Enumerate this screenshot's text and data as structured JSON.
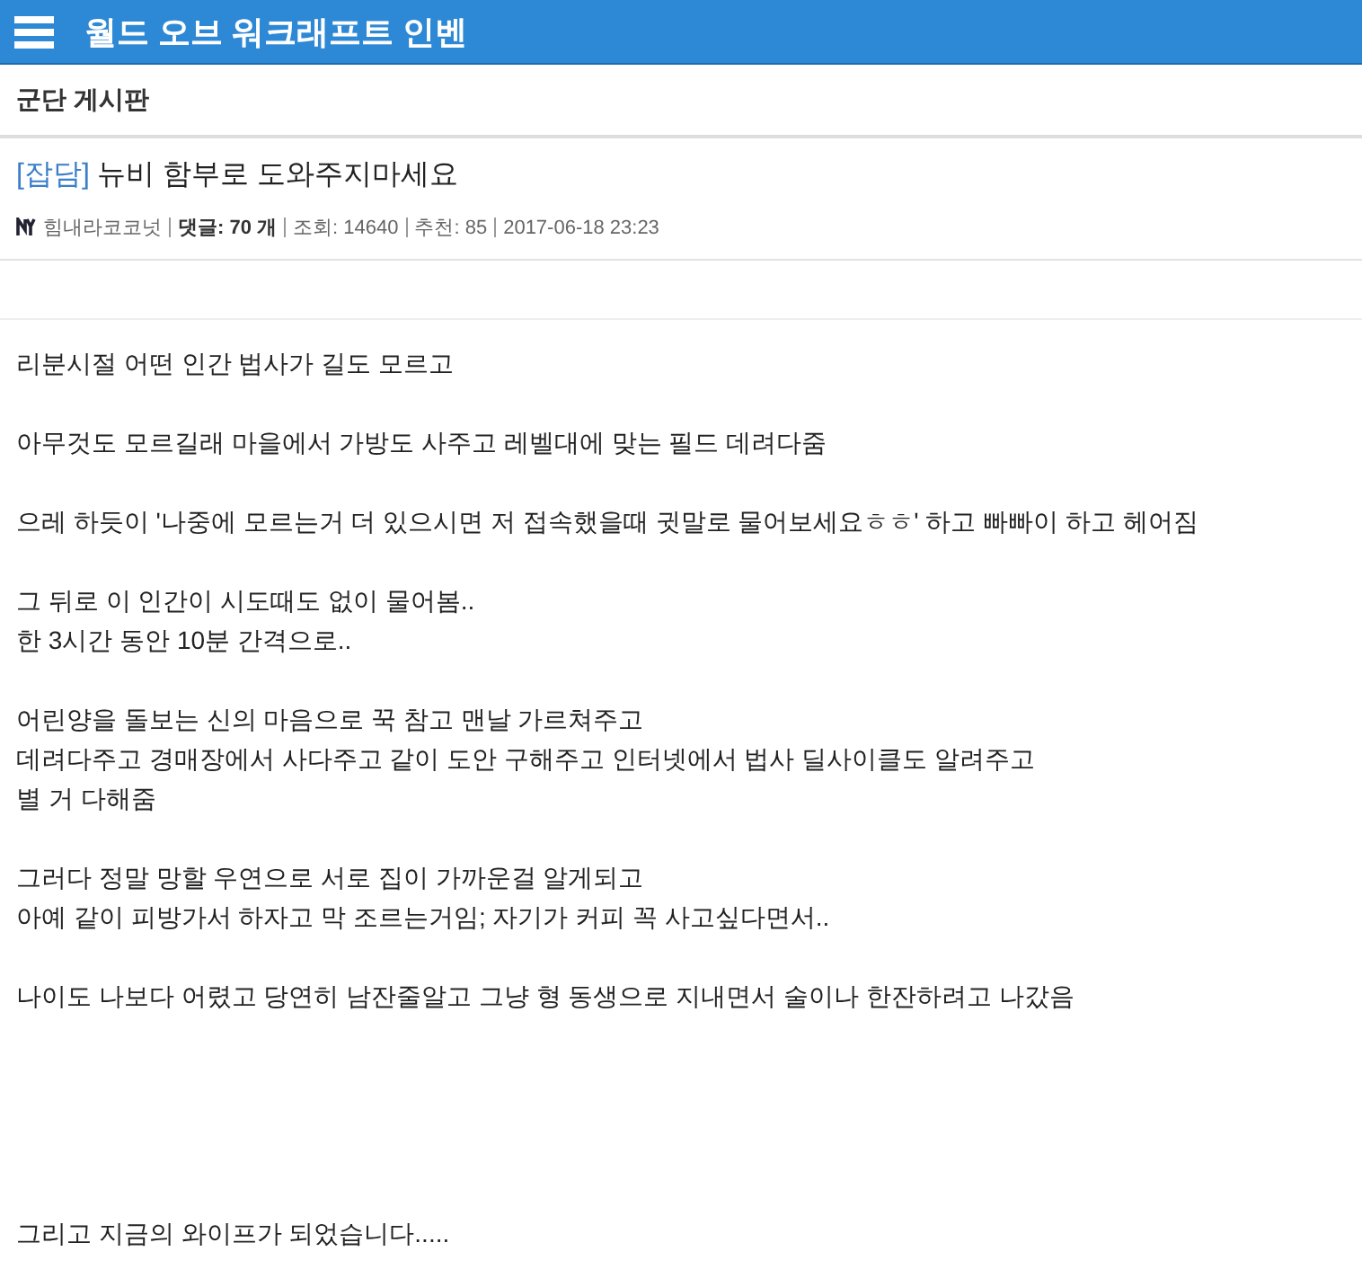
{
  "header": {
    "title": "월드 오브 워크래프트 인벤"
  },
  "board": {
    "title": "군단 게시판"
  },
  "post": {
    "category": "[잡담]",
    "title": "뉴비 함부로 도와주지마세요",
    "meta": {
      "author": "힘내라코코넛",
      "comments": "**댓글: 70 개**",
      "views": "조회: 14640",
      "recommends": "추천: 85",
      "date": "2017-06-18 23:23"
    },
    "paragraphs": [
      {
        "lines": [
          "리분시절 어떤 인간 법사가 길도 모르고"
        ]
      },
      {
        "lines": [
          "아무것도 모르길래 마을에서 가방도 사주고 레벨대에 맞는 필드 데려다줌"
        ]
      },
      {
        "lines": [
          "으레 하듯이 '나중에 모르는거 더 있으시면 저 접속했을때 귓말로 물어보세요ㅎㅎ' 하고 빠빠이 하고 헤어짐"
        ]
      },
      {
        "lines": [
          "그 뒤로 이 인간이 시도때도 없이 물어봄..",
          "한 3시간 동안 10분 간격으로.."
        ]
      },
      {
        "lines": [
          "어린양을 돌보는 신의 마음으로 꾹 참고 맨날 가르쳐주고",
          "데려다주고 경매장에서 사다주고 같이 도안 구해주고 인터넷에서 법사 딜사이클도 알려주고",
          "별 거 다해줌"
        ]
      },
      {
        "lines": [
          "그러다 정말 망할 우연으로 서로 집이 가까운걸 알게되고",
          "아예 같이 피방가서 하자고 막 조르는거임; 자기가 커피 꼭 사고싶다면서.."
        ]
      },
      {
        "lines": [
          "나이도 나보다 어렸고 당연히 남잔줄알고 그냥 형 동생으로 지내면서 술이나 한잔하려고 나갔음"
        ]
      },
      {
        "lines": [
          "그리고 지금의 와이프가 되었습니다....."
        ]
      }
    ]
  }
}
